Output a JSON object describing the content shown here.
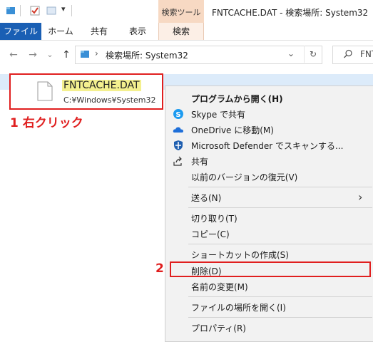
{
  "titlebar": {
    "context_tab_header": "検索ツール",
    "window_title": "FNTCACHE.DAT - 検索場所: System32"
  },
  "ribbon": {
    "tabs": [
      {
        "label": "ファイル"
      },
      {
        "label": "ホーム"
      },
      {
        "label": "共有"
      },
      {
        "label": "表示"
      },
      {
        "label": "検索"
      }
    ]
  },
  "navigation": {
    "back": "←",
    "forward": "→",
    "recent": "⌄",
    "up": "↑",
    "address_text": "検索場所: System32",
    "search_placeholder": "FNT"
  },
  "file": {
    "name": "FNTCACHE.DAT",
    "path": "C:¥Windows¥System32"
  },
  "steps": {
    "step1": "1  右クリック",
    "step2": "2"
  },
  "context_menu": {
    "items": [
      {
        "label": "プログラムから開く(H)",
        "icon": "",
        "bold": true
      },
      {
        "label": "Skype で共有",
        "icon": "skype-icon"
      },
      {
        "label": "OneDrive に移動(M)",
        "icon": "onedrive-icon"
      },
      {
        "label": "Microsoft Defender でスキャンする...",
        "icon": "defender-shield-icon"
      },
      {
        "label": "共有",
        "icon": "share-icon"
      },
      {
        "label": "以前のバージョンの復元(V)",
        "icon": ""
      },
      {
        "label": "送る(N)",
        "icon": "",
        "submenu": true
      },
      {
        "label": "切り取り(T)",
        "icon": ""
      },
      {
        "label": "コピー(C)",
        "icon": ""
      },
      {
        "label": "ショートカットの作成(S)",
        "icon": ""
      },
      {
        "label": "削除(D)",
        "icon": "",
        "highlighted": true
      },
      {
        "label": "名前の変更(M)",
        "icon": ""
      },
      {
        "label": "ファイルの場所を開く(I)",
        "icon": ""
      },
      {
        "label": "プロパティ(R)",
        "icon": ""
      }
    ]
  },
  "colors": {
    "accent_red": "#e01f1f",
    "ribbon_file_blue": "#1a5fb4",
    "context_tab_orange": "#f7d9c3",
    "selection_band": "#dcebfa",
    "filename_highlight": "#f4f08f"
  }
}
